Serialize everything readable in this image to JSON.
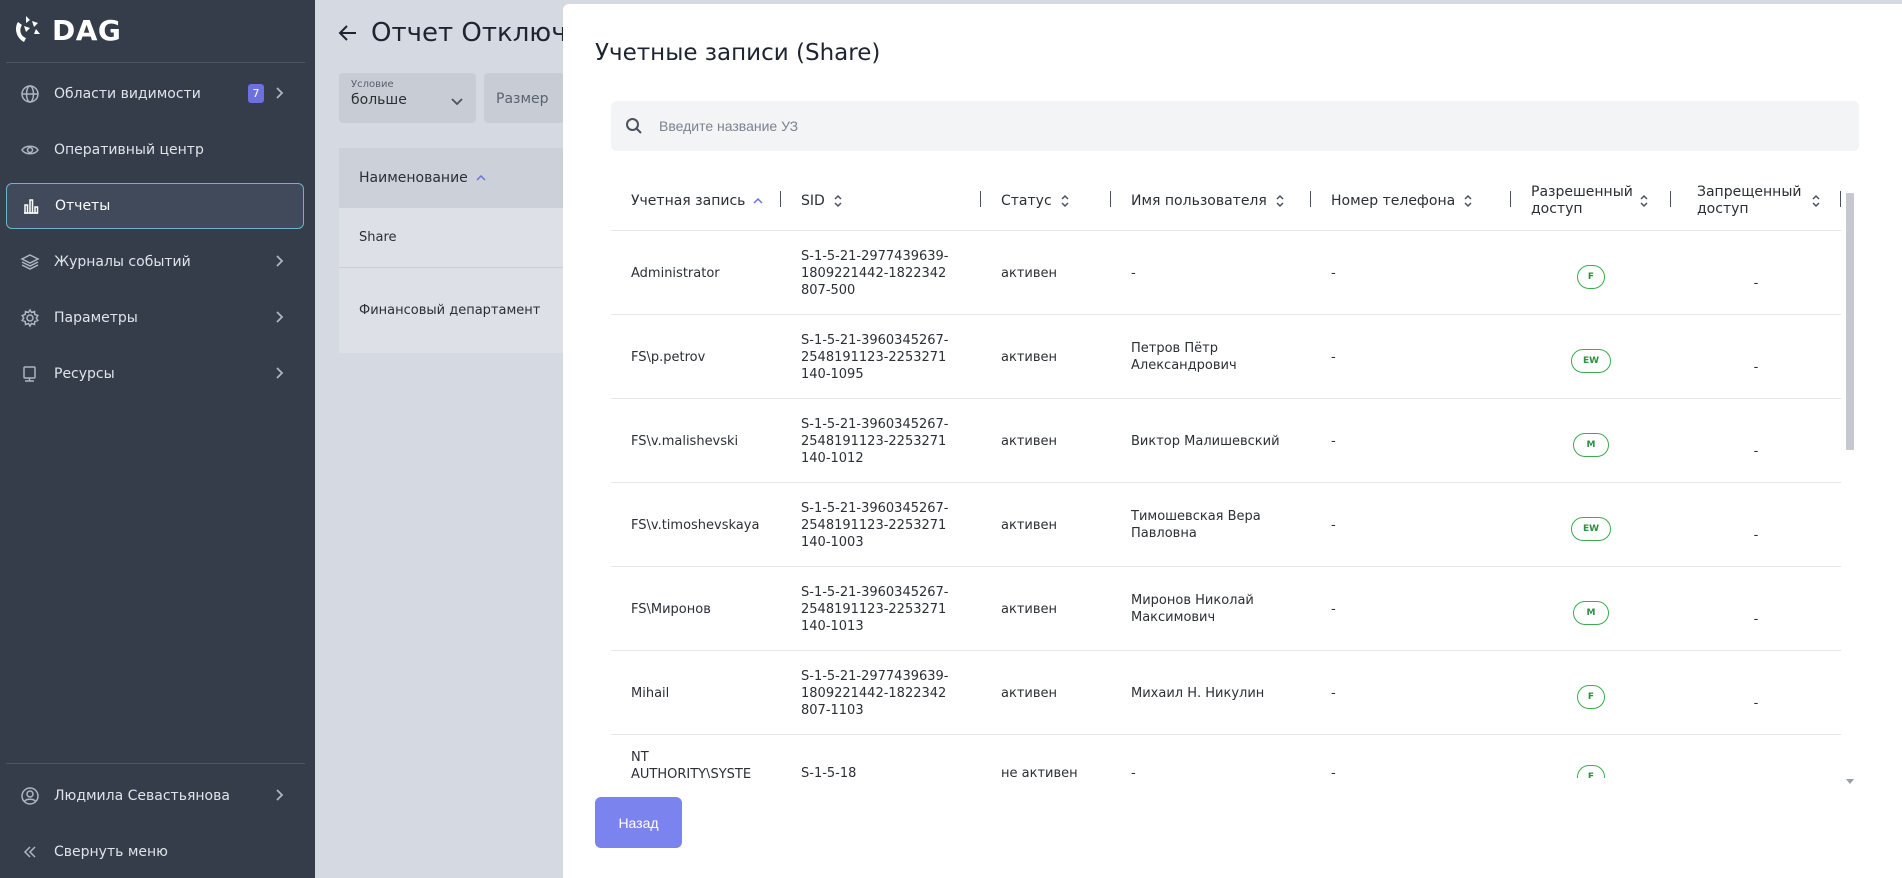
{
  "app": {
    "logo_text": "DAG"
  },
  "sidebar": {
    "items": [
      {
        "label": "Области видимости",
        "badge": "7"
      },
      {
        "label": "Оперативный центр"
      },
      {
        "label": "Отчеты"
      },
      {
        "label": "Журналы событий"
      },
      {
        "label": "Параметры"
      },
      {
        "label": "Ресурсы"
      }
    ],
    "user": "Людмила Севастьянова",
    "collapse": "Свернуть меню"
  },
  "background_page": {
    "title": "Отчет Отключе",
    "filters": {
      "condition_caption": "Условие",
      "condition_value": "больше",
      "size_caption": "Размер"
    },
    "table": {
      "header": "Наименование",
      "rows": [
        "Share",
        "Финансовый департамент"
      ]
    }
  },
  "modal": {
    "title": "Учетные записи (Share)",
    "search_placeholder": "Введите название УЗ",
    "columns": [
      "Учетная запись",
      "SID",
      "Статус",
      "Имя пользователя",
      "Номер телефона",
      "Разрешенный доступ",
      "Запрещенный доступ"
    ],
    "rows": [
      {
        "account": "Administrator",
        "sid": "S-1-5-21-2977439639-1809221442-1822342807-500",
        "status": "активен",
        "user": "-",
        "phone": "-",
        "allowed": "F",
        "denied": "-"
      },
      {
        "account": "FS\\p.petrov",
        "sid": "S-1-5-21-3960345267-2548191123-2253271140-1095",
        "status": "активен",
        "user": "Петров Пётр Александрович",
        "phone": "-",
        "allowed": "EW",
        "denied": "-"
      },
      {
        "account": "FS\\v.malishevski",
        "sid": "S-1-5-21-3960345267-2548191123-2253271140-1012",
        "status": "активен",
        "user": "Виктор Малишевский",
        "phone": "-",
        "allowed": "M",
        "denied": "-"
      },
      {
        "account": "FS\\v.timoshevskaya",
        "sid": "S-1-5-21-3960345267-2548191123-2253271140-1003",
        "status": "активен",
        "user": "Тимошевская Вера Павловна",
        "phone": "-",
        "allowed": "EW",
        "denied": "-"
      },
      {
        "account": "FS\\Миронов",
        "sid": "S-1-5-21-3960345267-2548191123-2253271140-1013",
        "status": "активен",
        "user": "Миронов Николай Максимович",
        "phone": "-",
        "allowed": "M",
        "denied": "-"
      },
      {
        "account": "Mihail",
        "sid": "S-1-5-21-2977439639-1809221442-1822342807-1103",
        "status": "активен",
        "user": "Михаил Н. Никулин",
        "phone": "-",
        "allowed": "F",
        "denied": "-"
      },
      {
        "account": "NT AUTHORITY\\SYSTE",
        "sid": "S-1-5-18",
        "status": "не активен",
        "user": "-",
        "phone": "-",
        "allowed": "F",
        "denied": "-"
      }
    ],
    "back_label": "Назад"
  },
  "colors": {
    "sidebar_bg": "#363d4a",
    "accent": "#7b83ee",
    "pill_green": "#3eaa4e",
    "active_border": "#6bb3c9"
  }
}
